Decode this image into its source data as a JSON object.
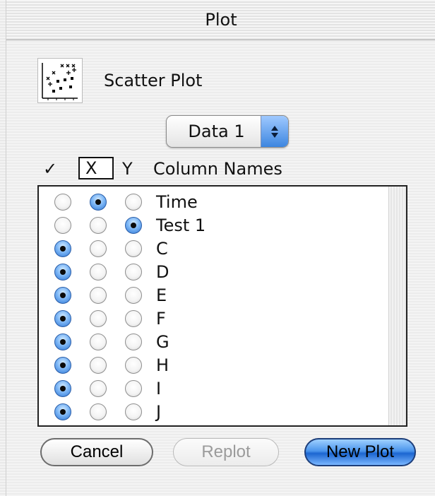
{
  "window": {
    "title": "Plot"
  },
  "plot_type": {
    "label": "Scatter Plot",
    "icon": "scatter-plot-icon"
  },
  "dataset": {
    "selected": "Data 1"
  },
  "headers": {
    "check": "✓",
    "x": "X",
    "y": "Y",
    "names": "Column Names"
  },
  "rows": [
    {
      "label": "Time",
      "check": false,
      "x": true,
      "y": false
    },
    {
      "label": "Test 1",
      "check": false,
      "x": false,
      "y": true
    },
    {
      "label": "C",
      "check": true,
      "x": false,
      "y": false
    },
    {
      "label": "D",
      "check": true,
      "x": false,
      "y": false
    },
    {
      "label": "E",
      "check": true,
      "x": false,
      "y": false
    },
    {
      "label": "F",
      "check": true,
      "x": false,
      "y": false
    },
    {
      "label": "G",
      "check": true,
      "x": false,
      "y": false
    },
    {
      "label": "H",
      "check": true,
      "x": false,
      "y": false
    },
    {
      "label": "I",
      "check": true,
      "x": false,
      "y": false
    },
    {
      "label": "J",
      "check": true,
      "x": false,
      "y": false
    }
  ],
  "buttons": {
    "cancel": "Cancel",
    "replot": "Replot",
    "new_plot": "New Plot"
  },
  "colors": {
    "accent": "#3d86e0",
    "default_button": "#1c66d1",
    "disabled_text": "#9b9b9b"
  }
}
